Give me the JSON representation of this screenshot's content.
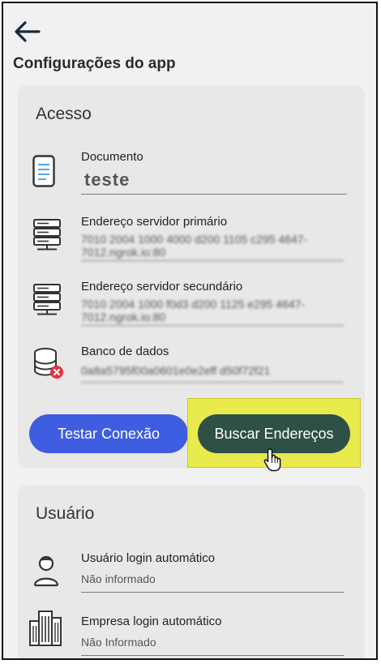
{
  "header": {
    "title": "Configurações do app"
  },
  "acesso": {
    "title": "Acesso",
    "fields": [
      {
        "label": "Documento",
        "value": "teste"
      },
      {
        "label": "Endereço servidor primário",
        "value": "7010 2004 1000 4000 d200 1105 c295 4647-7012.ngrok.io:80"
      },
      {
        "label": "Endereço servidor secundário",
        "value": "7010 2004 1000 f0d3 d200 1125 e295 4647-7012.ngrok.io:80"
      },
      {
        "label": "Banco de dados",
        "value": "0a8a5795f00a0601e0e2eff d50f72f21"
      }
    ],
    "buttons": {
      "test": "Testar Conexão",
      "find": "Buscar Endereços"
    }
  },
  "usuario": {
    "title": "Usuário",
    "fields": [
      {
        "label": "Usuário login automático",
        "value": "Não informado"
      },
      {
        "label": "Empresa login automático",
        "value": "Não Informado"
      }
    ]
  },
  "icons": [
    "back-arrow-icon",
    "document-icon",
    "server-icon",
    "server-icon",
    "database-error-icon",
    "user-icon",
    "building-icon",
    "hand-pointer-icon"
  ]
}
